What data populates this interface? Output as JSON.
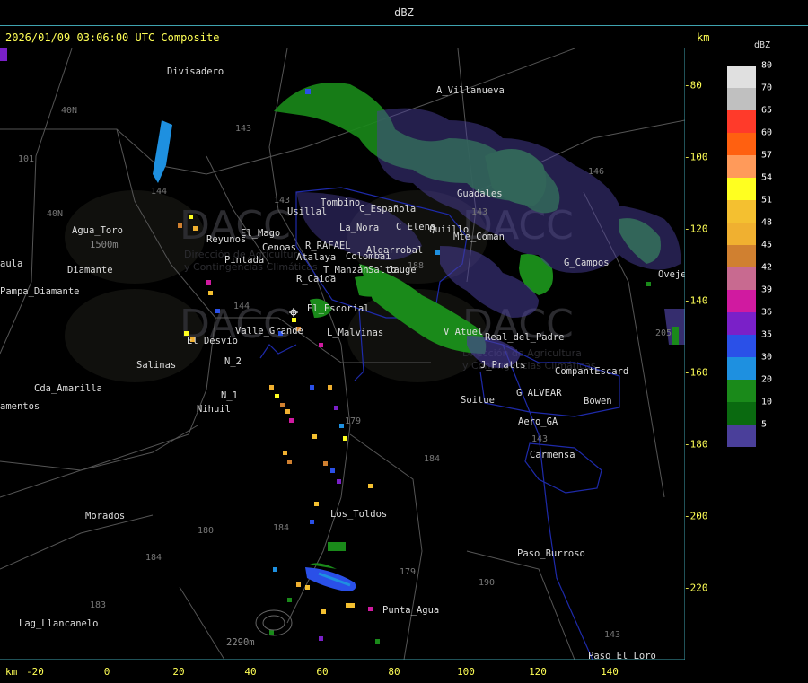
{
  "header": {
    "title": "dBZ"
  },
  "map": {
    "timestamp": "2026/01/09 03:06:00 UTC Composite",
    "unit_top": "km",
    "unit_bottom": "km",
    "x_ticks": [
      "-20",
      "0",
      "20",
      "40",
      "60",
      "80",
      "100",
      "120",
      "140"
    ],
    "y_ticks": [
      "-80",
      "-100",
      "-120",
      "-140",
      "-160",
      "-180",
      "-200",
      "-220"
    ],
    "watermark": "DACC",
    "watermark_sub_1": "Dirección de Agricultura",
    "watermark_sub_2": "y Contingencias Climáticas",
    "places": [
      "Divisadero",
      "A_Villanueva",
      "Guadales",
      "Usillal",
      "Tombino",
      "C_Española",
      "La_Nora",
      "C_Elena",
      "Quiillo",
      "Mte_Coman",
      "Reyunos",
      "El_Mago",
      "Pintada",
      "Cenoas",
      "R_RAFAEL",
      "Algarrobal",
      "Atalaya",
      "Colombai",
      "T_Manzán",
      "Salto",
      "Jauge",
      "R_Caida",
      "G_Campos",
      "Oveje",
      "El_Escorial",
      "L_Malvinas",
      "Valle_Grande",
      "El_Desvío",
      "Salinas",
      "N_2",
      "N_1",
      "Nihuil",
      "Cda_Amarilla",
      "amentos",
      "aula",
      "Pampa_Diamante",
      "Agua_Toro",
      "Diamante",
      "V_Atuel",
      "J_Pratts",
      "Real_del_Padre",
      "G_ALVEAR",
      "Soitue",
      "Aero_GA",
      "Bowen",
      "CompantEscard",
      "Carmensa",
      "Los_Toldos",
      "Morados",
      "Paso_Burroso",
      "Punta_Agua",
      "Lag_Llancanelo",
      "Paso_El_Loro",
      "2290m",
      "1500m"
    ],
    "route_numbers": [
      "143",
      "143",
      "146",
      "143",
      "101",
      "40N",
      "40N",
      "144",
      "144",
      "180",
      "184",
      "179",
      "188",
      "184",
      "183",
      "184",
      "179",
      "190",
      "143",
      "143",
      "205"
    ]
  },
  "legend": {
    "title": "dBZ",
    "levels": [
      {
        "label": "80",
        "color": "#e0e0e0"
      },
      {
        "label": "70",
        "color": "#c0c0c0"
      },
      {
        "label": "65",
        "color": "#ff3a2a"
      },
      {
        "label": "60",
        "color": "#ff6010"
      },
      {
        "label": "57",
        "color": "#ff9a5a"
      },
      {
        "label": "54",
        "color": "#ffff20"
      },
      {
        "label": "51",
        "color": "#f4c030"
      },
      {
        "label": "48",
        "color": "#f0b030"
      },
      {
        "label": "45",
        "color": "#d08030"
      },
      {
        "label": "42",
        "color": "#c86a90"
      },
      {
        "label": "39",
        "color": "#d01aa0"
      },
      {
        "label": "36",
        "color": "#7a20c8"
      },
      {
        "label": "35",
        "color": "#2a50e8"
      },
      {
        "label": "30",
        "color": "#1e90e0"
      },
      {
        "label": "20",
        "color": "#1a8a1a"
      },
      {
        "label": "10",
        "color": "#0a6a10"
      },
      {
        "label": "5",
        "color": "#4a3f9a"
      }
    ]
  }
}
